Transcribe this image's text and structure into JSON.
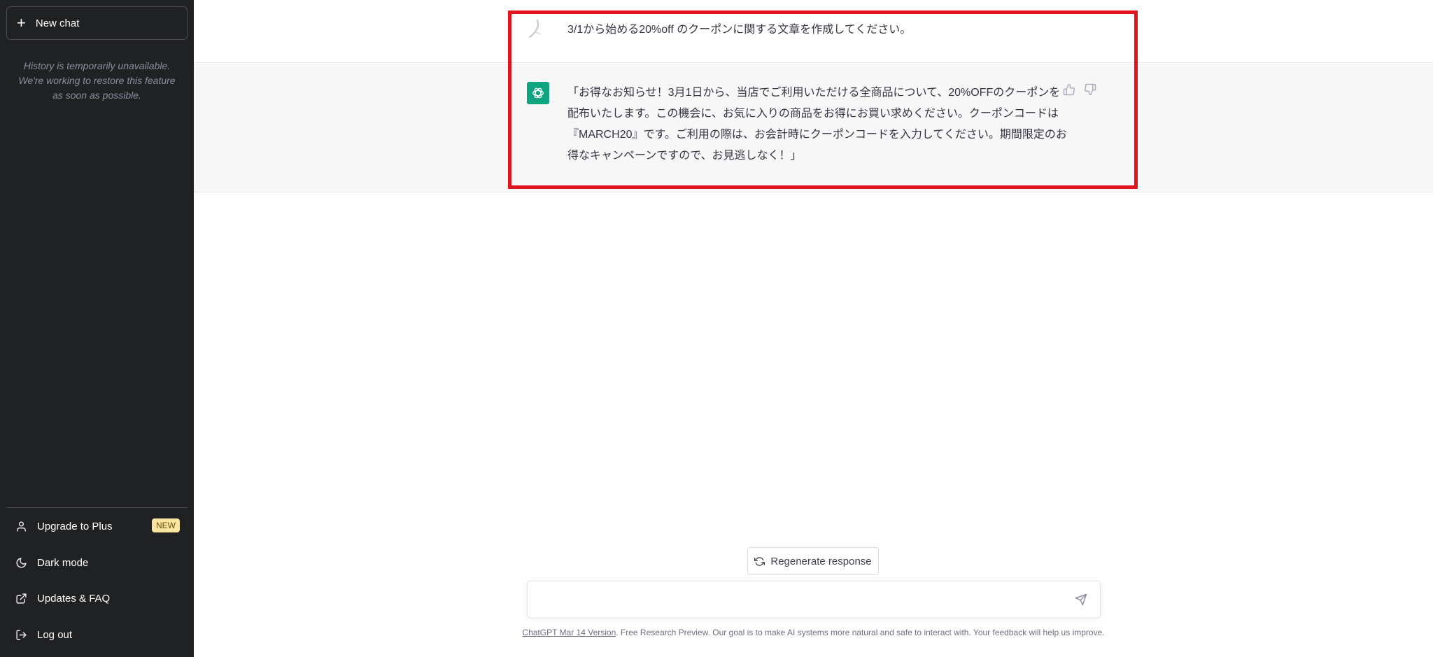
{
  "sidebar": {
    "new_chat_label": "New chat",
    "history_message": "History is temporarily unavailable. We're working to restore this feature as soon as possible.",
    "items": [
      {
        "label": "Upgrade to Plus",
        "icon": "user-icon",
        "badge": "NEW"
      },
      {
        "label": "Dark mode",
        "icon": "moon-icon"
      },
      {
        "label": "Updates & FAQ",
        "icon": "external-link-icon"
      },
      {
        "label": "Log out",
        "icon": "logout-icon"
      }
    ]
  },
  "conversation": {
    "user_message": "3/1から始める20%off のクーポンに関する文章を作成してください。",
    "assistant_message": "「お得なお知らせ！3月1日から、当店でご利用いただける全商品について、20%OFFのクーポンを配布いたします。この機会に、お気に入りの商品をお得にお買い求めください。クーポンコードは『MARCH20』です。ご利用の際は、お会計時にクーポンコードを入力してください。期間限定のお得なキャンペーンですので、お見逃しなく！」"
  },
  "input": {
    "regenerate_label": "Regenerate response",
    "placeholder": ""
  },
  "footer": {
    "version_link": "ChatGPT Mar 14 Version",
    "text": ". Free Research Preview. Our goal is to make AI systems more natural and safe to interact with. Your feedback will help us improve."
  },
  "colors": {
    "sidebar_bg": "#202123",
    "assistant_row_bg": "#f7f7f8",
    "brand_green": "#10a37f",
    "highlight_red": "#e3141d",
    "badge_yellow": "#fae69e"
  }
}
